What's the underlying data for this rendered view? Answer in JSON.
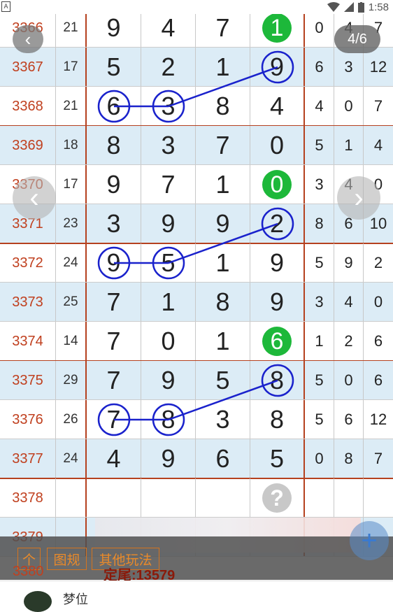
{
  "status_bar": {
    "left_icon": "A",
    "time": "1:58",
    "wifi_icon": "wifi-icon",
    "signal_icon": "signal-icon",
    "battery_icon": "battery-icon"
  },
  "viewer": {
    "back_label": "‹",
    "page_indicator": "4/6",
    "prev_label": "‹",
    "next_label": "›"
  },
  "table": {
    "rows": [
      {
        "issue": "3366",
        "sum": "21",
        "d": [
          "9",
          "4",
          "7",
          "1"
        ],
        "s": [
          "0",
          "4",
          "7"
        ],
        "shade": false,
        "green": 3
      },
      {
        "issue": "3367",
        "sum": "17",
        "d": [
          "5",
          "2",
          "1",
          "9"
        ],
        "s": [
          "6",
          "3",
          "12"
        ],
        "shade": true
      },
      {
        "issue": "3368",
        "sum": "21",
        "d": [
          "6",
          "3",
          "8",
          "4"
        ],
        "s": [
          "4",
          "0",
          "7"
        ],
        "shade": false
      },
      {
        "issue": "3369",
        "sum": "18",
        "d": [
          "8",
          "3",
          "7",
          "0"
        ],
        "s": [
          "5",
          "1",
          "4"
        ],
        "shade": true
      },
      {
        "issue": "3370",
        "sum": "17",
        "d": [
          "9",
          "7",
          "1",
          "0"
        ],
        "s": [
          "3",
          "4",
          "0"
        ],
        "shade": false,
        "green": 3
      },
      {
        "issue": "3371",
        "sum": "23",
        "d": [
          "3",
          "9",
          "9",
          "2"
        ],
        "s": [
          "8",
          "6",
          "10"
        ],
        "shade": true
      },
      {
        "issue": "3372",
        "sum": "24",
        "d": [
          "9",
          "5",
          "1",
          "9"
        ],
        "s": [
          "5",
          "9",
          "2"
        ],
        "shade": false
      },
      {
        "issue": "3373",
        "sum": "25",
        "d": [
          "7",
          "1",
          "8",
          "9"
        ],
        "s": [
          "3",
          "4",
          "0"
        ],
        "shade": true
      },
      {
        "issue": "3374",
        "sum": "14",
        "d": [
          "7",
          "0",
          "1",
          "6"
        ],
        "s": [
          "1",
          "2",
          "6"
        ],
        "shade": false,
        "green": 3
      },
      {
        "issue": "3375",
        "sum": "29",
        "d": [
          "7",
          "9",
          "5",
          "8"
        ],
        "s": [
          "5",
          "0",
          "6"
        ],
        "shade": true
      },
      {
        "issue": "3376",
        "sum": "26",
        "d": [
          "7",
          "8",
          "3",
          "8"
        ],
        "s": [
          "5",
          "6",
          "12"
        ],
        "shade": false
      },
      {
        "issue": "3377",
        "sum": "24",
        "d": [
          "4",
          "9",
          "6",
          "5"
        ],
        "s": [
          "0",
          "8",
          "7"
        ],
        "shade": true
      },
      {
        "issue": "3378",
        "sum": "",
        "d": [
          "",
          "",
          "",
          ""
        ],
        "s": [
          "",
          "",
          ""
        ],
        "shade": false,
        "question": 3
      },
      {
        "issue": "3379",
        "sum": "",
        "d": [
          "",
          "",
          "",
          ""
        ],
        "s": [
          "",
          "",
          ""
        ],
        "shade": true
      }
    ],
    "question_mark": "?"
  },
  "toolbar": {
    "btn1": "个",
    "btn2": "图规",
    "btn3": "其他玩法",
    "fab_label": "+"
  },
  "footer": {
    "issue": "3380",
    "text": "定尾:13579",
    "user_name": "梦位"
  },
  "colors": {
    "issue_red": "#c0401f",
    "separator": "#b5411f",
    "row_shade": "#dcecf6",
    "green_ball": "#1db83a",
    "circle_blue": "#1a22cc",
    "toolbar_orange": "#e98a2a"
  }
}
